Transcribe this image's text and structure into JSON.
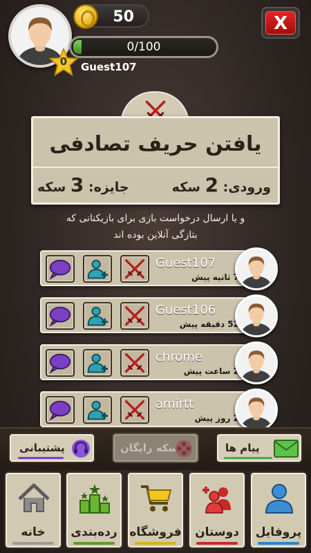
{
  "header": {
    "coins": "50",
    "xp": "0/100",
    "xp_progress": 0.0,
    "level": "0",
    "username": "Guest107",
    "close_label": "X"
  },
  "banner": {
    "title": "یافتن حریف تصادفی",
    "entry_label": "ورودی:",
    "entry_amount": "2",
    "entry_unit": "سکه",
    "prize_label": "جایزه:",
    "prize_amount": "3",
    "prize_unit": "سکه"
  },
  "description": {
    "line1": "و یا ارسال درخواست بازی برای بازیکنانی که",
    "line2": "بتازگی آنلاین بوده اند"
  },
  "players": [
    {
      "name": "Guest107",
      "time": "7 ثانیه پیش"
    },
    {
      "name": "Guest106",
      "time": "52 دقیقه پیش"
    },
    {
      "name": "chrome",
      "time": "2 ساعت پیش"
    },
    {
      "name": "amirtt",
      "time": "2 روز پیش"
    }
  ],
  "actions": {
    "support": "پشتیبانی",
    "free_coins": "سکه رایگان",
    "messages": "پیام ها"
  },
  "nav": {
    "home": "خانه",
    "ranking": "رده‌بندی",
    "shop": "فروشگاه",
    "friends": "دوستان",
    "profile": "پروفایل"
  },
  "colors": {
    "panel": "#ccc3ad",
    "support_line": "#7a3fd0",
    "messages_line": "#4cb040",
    "home_line": "#9a9a9a",
    "ranking_line": "#5aa02c",
    "shop_line": "#d8b21c",
    "friends_line": "#c82a2a",
    "profile_line": "#2c82c9"
  }
}
